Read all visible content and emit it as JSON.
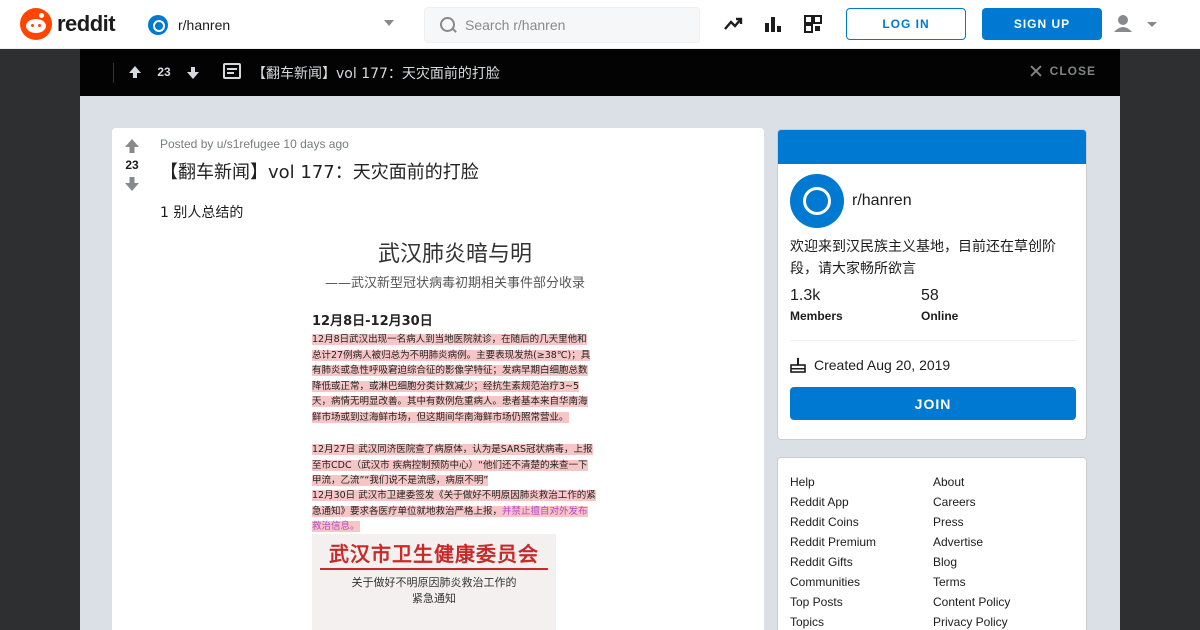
{
  "header": {
    "logo_text": "reddit",
    "community": "r/hanren",
    "search_placeholder": "Search r/hanren",
    "icons": [
      "trending-icon",
      "leaderboard-icon",
      "coins-icon"
    ],
    "login_label": "LOG IN",
    "signup_label": "SIGN UP"
  },
  "post_bar": {
    "vote_count": "23",
    "title": "【翻车新闻】vol 177：天灾面前的打脸",
    "close_label": "CLOSE"
  },
  "post": {
    "vote_count": "23",
    "meta": "Posted by u/s1refugee 10 days ago",
    "title": "【翻车新闻】vol 177：天灾面前的打脸",
    "body": "1 别人总结的",
    "image": {
      "title": "武汉肺炎暗与明",
      "subtitle": "——武汉新型冠状病毒初期相关事件部分收录",
      "dates": "12月8日-12月30日",
      "para1": "12月8日武汉出现一名病人到当地医院就诊，在随后的几天里他和总计27例病人被归总为不明肺炎病例。主要表现发热(≥38℃)；具有肺炎或急性呼吸窘迫综合征的影像学特征；发病早期白细胞总数降低或正常，或淋巴细胞分类计数减少；经抗生素规范治疗3~5天，病情无明显改善。其中有数例危重病人。患者基本来自华南海鲜市场或到过海鲜市场，但这期间华南海鲜市场仍照常营业。",
      "para2": "12月27日 武汉同济医院查了病原体，认为是SARS冠状病毒，上报至市CDC（武汉市 疾病控制预防中心）“他们还不清楚的来查一下甲流，乙流”“我们说不是流感，病原不明”",
      "para3a": "12月30日 武汉市卫建委签发《关于做好不明原因肺炎救治工作的紧急通知》要求各医疗单位就地救治严格上报，",
      "para3b": "并禁止擅自对外发布救治信息。",
      "doc_head": "武汉市卫生健康委员会",
      "doc_line1": "关于做好不明原因肺炎救治工作的",
      "doc_line2": "紧急通知"
    }
  },
  "about": {
    "name": "r/hanren",
    "description": "欢迎来到汉民族主义基地，目前还在草创阶段，请大家畅所欲言",
    "members_value": "1.3k",
    "members_label": "Members",
    "online_value": "58",
    "online_label": "Online",
    "created": "Created Aug 20, 2019",
    "join_label": "JOIN"
  },
  "footer_links": {
    "left": [
      "Help",
      "Reddit App",
      "Reddit Coins",
      "Reddit Premium",
      "Reddit Gifts",
      "Communities",
      "Top Posts",
      "Topics"
    ],
    "right": [
      "About",
      "Careers",
      "Press",
      "Advertise",
      "Blog",
      "Terms",
      "Content Policy",
      "Privacy Policy"
    ]
  },
  "colors": {
    "brand": "#ff4500",
    "accent": "#0079d3",
    "page_bg": "#dae0e6"
  }
}
